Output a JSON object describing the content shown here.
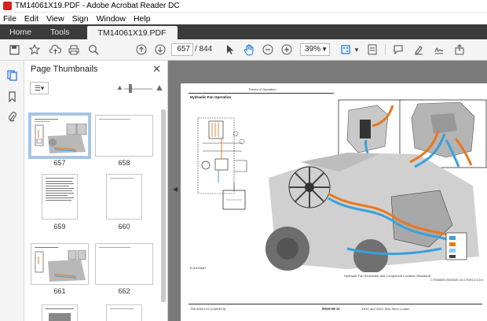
{
  "window": {
    "title": "TM14061X19.PDF - Adobe Acrobat Reader DC"
  },
  "menu": [
    "File",
    "Edit",
    "View",
    "Sign",
    "Window",
    "Help"
  ],
  "tabs": {
    "home": "Home",
    "tools": "Tools",
    "document": "TM14061X19.PDF"
  },
  "toolbar": {
    "current_page": "657",
    "total_pages": "/ 844",
    "zoom": "39%"
  },
  "panel": {
    "title": "Page Thumbnails"
  },
  "thumbnails": [
    {
      "label": "657",
      "selected": true
    },
    {
      "label": "658",
      "selected": false
    },
    {
      "label": "659",
      "selected": false
    },
    {
      "label": "660",
      "selected": false
    },
    {
      "label": "661",
      "selected": false
    },
    {
      "label": "662",
      "selected": false
    }
  ],
  "page": {
    "header": "Theory of Operation",
    "title": "Hydraulic Fan Operation",
    "figure_id": "EJ1029667",
    "figure_caption": "Hydraulic Fan Schematic and Component Location (Standard)",
    "footer_left": "TM14061X19 (11MAR15)",
    "footer_page": "9026-08-11",
    "footer_right": "330G and 332G Skid Steer Loader",
    "corner_code": "CT946555,0000020-19-07DEC14-1/4"
  },
  "colors": {
    "tabbar": "#3b3b3b",
    "accent": "#1473e6",
    "doc_bg": "#7a7a7a",
    "hydraulic_orange": "#e8781e",
    "hydraulic_blue": "#3aa0d8"
  }
}
